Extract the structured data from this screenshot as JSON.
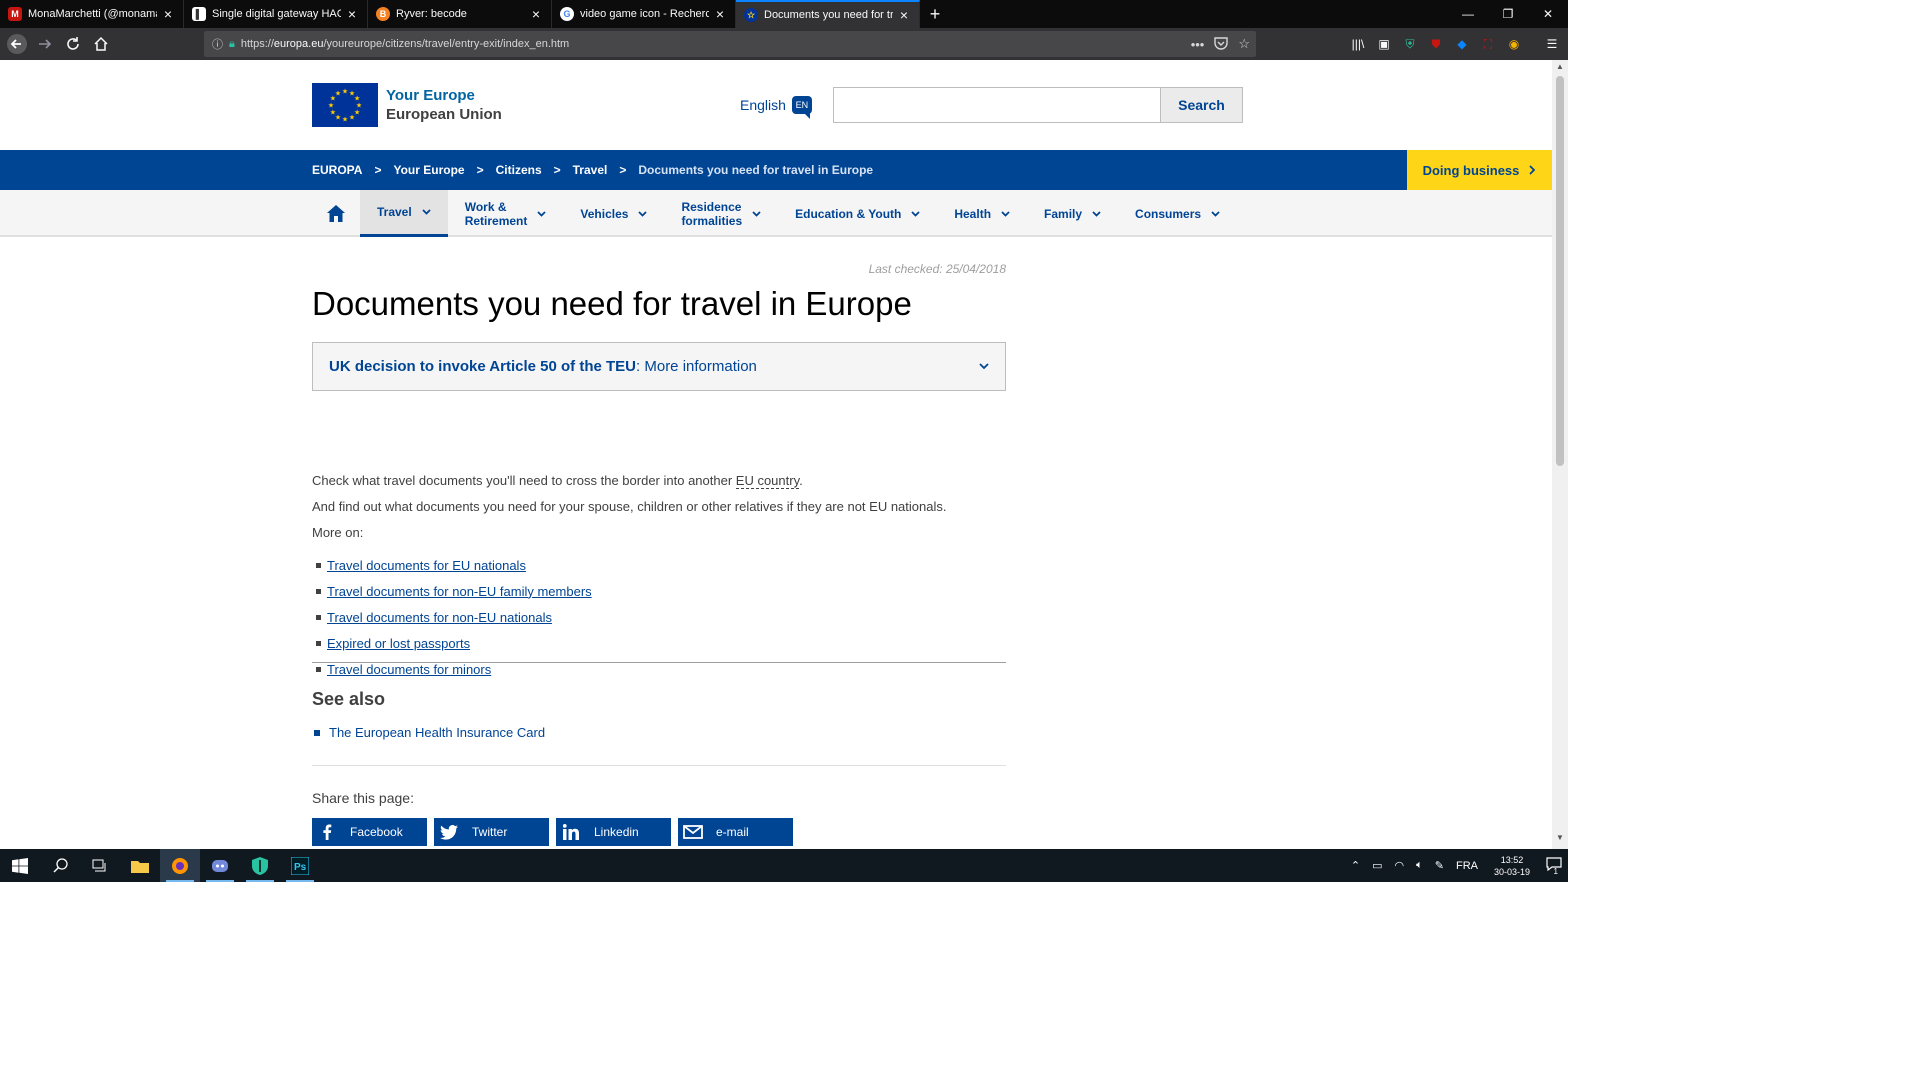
{
  "browser": {
    "tabs": [
      {
        "title": "MonaMarchetti (@monamarchetti)",
        "favicon_color": "#c71610",
        "favicon_glyph": "M"
      },
      {
        "title": "Single digital gateway HACKATHON",
        "favicon_color": "#ffffff",
        "favicon_glyph": "▌"
      },
      {
        "title": "Ryver: becode",
        "favicon_color": "#f58220",
        "favicon_glyph": "B"
      },
      {
        "title": "video game icon - Recherche Google",
        "favicon_color": "#ffffff",
        "favicon_glyph": "G"
      },
      {
        "title": "Documents you need for travel in Europe",
        "favicon_color": "#003399",
        "favicon_glyph": "☆",
        "active": true
      }
    ],
    "url_prefix": "https://",
    "url_host": "europa.eu",
    "url_path": "/youreurope/citizens/travel/entry-exit/index_en.htm",
    "new_tab_label": "+",
    "menu_dots": "•••",
    "pocket_icon": "pocket-icon",
    "bookmark_icon": "star-icon"
  },
  "header": {
    "brand_line1": "Your Europe",
    "brand_line2": "European Union",
    "language": "English",
    "language_code": "EN",
    "search_placeholder": "",
    "search_button": "Search"
  },
  "breadcrumb": {
    "items": [
      "EUROPA",
      "Your Europe",
      "Citizens",
      "Travel"
    ],
    "separator": ">",
    "current": "Documents you need for travel in Europe",
    "doing_business": "Doing business"
  },
  "mainnav": {
    "items": [
      {
        "label": "Travel",
        "active": true
      },
      {
        "label": "Work &\nRetirement"
      },
      {
        "label": "Vehicles"
      },
      {
        "label": "Residence\nformalities"
      },
      {
        "label": "Education & Youth"
      },
      {
        "label": "Health"
      },
      {
        "label": "Family"
      },
      {
        "label": "Consumers"
      }
    ]
  },
  "content": {
    "last_checked": "Last checked: 25/04/2018",
    "title": "Documents you need for travel in Europe",
    "notice_bold": "UK decision to invoke Article 50 of the TEU",
    "notice_link": ": More information",
    "para1_before": "Check what travel documents you'll need to cross the border into another ",
    "para1_abbr": "EU country",
    "para1_after": ".",
    "para2": "And find out what documents you need for your spouse, children or other relatives if they are not EU nationals.",
    "para3": "More on:",
    "links": [
      "Travel documents for EU nationals",
      "Travel documents for non-EU family members",
      "Travel documents for non-EU nationals",
      "Expired or lost passports",
      "Travel documents for minors"
    ],
    "see_also_title": "See also",
    "see_also_items": [
      "The European Health Insurance Card"
    ],
    "share_title": "Share this page:",
    "share_buttons": [
      "Facebook",
      "Twitter",
      "Linkedin",
      "e-mail"
    ]
  },
  "taskbar": {
    "language": "FRA",
    "time": "13:52",
    "date": "30-03-19",
    "notification_count": "1"
  }
}
